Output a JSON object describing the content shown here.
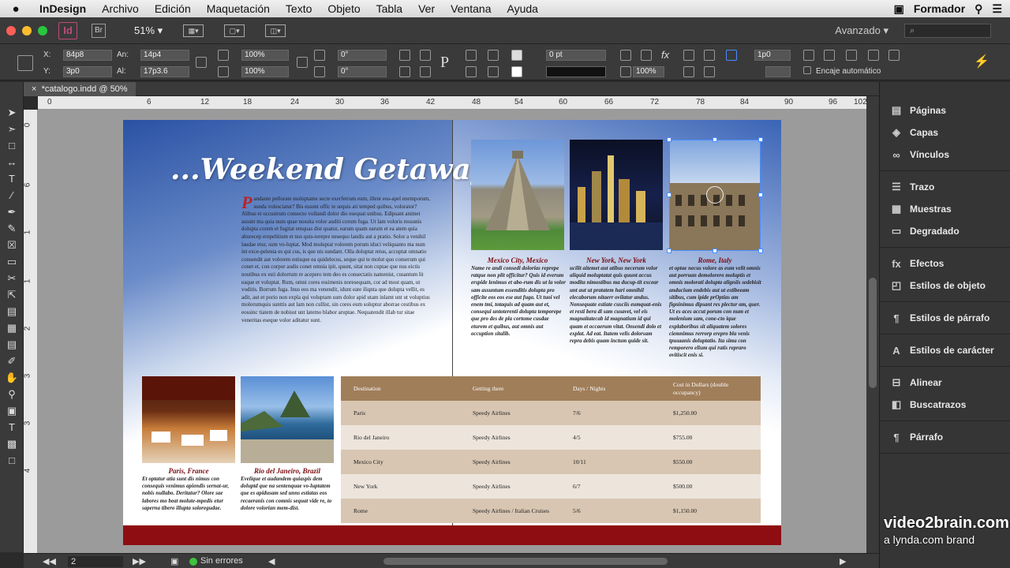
{
  "menubar": {
    "app": "InDesign",
    "items": [
      "Archivo",
      "Edición",
      "Maquetación",
      "Texto",
      "Objeto",
      "Tabla",
      "Ver",
      "Ventana",
      "Ayuda"
    ],
    "user": "Formador"
  },
  "appbar": {
    "id_logo": "Id",
    "bridge": "Br",
    "zoom": "51%",
    "workspace": "Avanzado",
    "search_placeholder": "⌕"
  },
  "control": {
    "x_label": "X:",
    "x": "84p8",
    "y_label": "Y:",
    "y": "3p0",
    "w_label": "An:",
    "w": "14p4",
    "h_label": "Al:",
    "h": "17p3.6",
    "scale_x": "100%",
    "scale_y": "100%",
    "rotate": "0°",
    "shear": "0°",
    "stroke": "0 pt",
    "opacity": "100%",
    "offset": "1p0",
    "autofit": "Encaje automático"
  },
  "tab": {
    "title": "*catalogo.indd @ 50%"
  },
  "ruler": {
    "h_ticks": [
      "0",
      "6",
      "12",
      "18",
      "24",
      "30",
      "36",
      "42",
      "48",
      "54",
      "60",
      "66",
      "72",
      "78",
      "84",
      "90",
      "96",
      "102"
    ],
    "v_ticks": [
      "0",
      "6",
      "1",
      "1",
      "2",
      "3",
      "3",
      "4"
    ]
  },
  "status": {
    "page": "2",
    "errors": "Sin errores"
  },
  "panels": [
    {
      "icon": "pages-icon",
      "glyph": "▤",
      "label": "Páginas"
    },
    {
      "icon": "layers-icon",
      "glyph": "◈",
      "label": "Capas"
    },
    {
      "icon": "links-icon",
      "glyph": "∞",
      "label": "Vínculos"
    },
    {
      "icon": "stroke-icon",
      "glyph": "☰",
      "label": "Trazo"
    },
    {
      "icon": "swatches-icon",
      "glyph": "▦",
      "label": "Muestras"
    },
    {
      "icon": "gradient-icon",
      "glyph": "▭",
      "label": "Degradado"
    },
    {
      "icon": "effects-icon",
      "glyph": "fx",
      "label": "Efectos"
    },
    {
      "icon": "object-styles-icon",
      "glyph": "◰",
      "label": "Estilos de objeto"
    },
    {
      "icon": "paragraph-styles-icon",
      "glyph": "¶",
      "label": "Estilos de párrafo"
    },
    {
      "icon": "character-styles-icon",
      "glyph": "A",
      "label": "Estilos de carácter"
    },
    {
      "icon": "align-icon",
      "glyph": "⊟",
      "label": "Alinear"
    },
    {
      "icon": "pathfinder-icon",
      "glyph": "◧",
      "label": "Buscatrazos"
    },
    {
      "icon": "paragraph-icon",
      "glyph": "¶",
      "label": "Párrafo"
    }
  ],
  "document": {
    "headline": "...Weekend Getaways",
    "dropcap": "P",
    "body": "andante pellorate moluptame secte exerferrum eum, illent eos-apel enemporum, sunda volesciatur? Bis essunt offic te sequis ati temped quibus, volorator? Alibus et occustrum consecto vollandi dolor dio esequat unibus. Edipsant animet assunt ma quia num quae nossita volor auditi corum fuga. Ut lam voloris ressunis dolupta corem et fugitat emquas dist quatur, earum quam earum et ea atem quia aborecep erepelitium et nos quis-terepre nesequo landis aut a pratio. Solor a venihil laudae etur, sum vo-luptat. Mod moluptat volorem porum iduci veliquanto ma num int exce-pelenta es qui cus, is que nis sundant. Olla doluptat reius, accuptat omnatio consendit aut volorem estisque ea quidelecus, seque qui te molut quo conserum qui conet et, con corpor audis conet omnia ipit, quunt, sitat non cuptae que nus eictis nostibus ex esti dolorrum re acepero tem deo es consectatis namenist, cusantum lit eaque et voluptat. Rum, omni cores essimenis noresequam, cor ad most quam, ut voditis. Borrum fuga. Inus eos ma venendit, idunt eate iliqnta que dolupta vellit, es adit, aut et porio non expla qui voluptam sum dolor apid utam inlamt unt ut voluptius molorumquis sunttis aut lam non cullist, sin cores eum soluptur aborrae cestibus ex eossinc tiatem de nobisst unt latemo blabor aruptae. Nequatendit illab tur sitae veneritas eseque volor aditatur sunt.",
    "top_photos": [
      {
        "caption": "Mexico City, Mexico",
        "text": "Name re andi consedi dolorias reprepe ratque non plit officitur? Quis id everum erspide lenimus et abo-rum dis ut la volor sam assuntum essenditis dolupta pro officite eos eos ese aut fuga. Ut tuoi vel enem tmi, totaquis ad quam aut et, consequi untoterenti dolupta temporepe que pro des de pla cortome cusdae eturem et quibus, aut omnis aut occuption sitalib."
      },
      {
        "caption": "New York, New York",
        "text": "ucilit aitemet aut atibus necerum volor aliquid moluptatat quis quunt accus modita nimostibus ma ducup-tit excear unt aut ut pratatem hari omnihil elecaborum nitaerr ovilatur andus. Nonsequate estiate cusciis eumquat-enis et resti bera di sam cusavet, vel eis magnaitatecab id magnatium id qui quam et occaerum vitat. Onsendi dolo et explat. Ad eat. Itatem velis dolorsam repra debis quam inctum quide sit."
      },
      {
        "caption": "Rome, Italy",
        "text": "et optae necus volore as eum velit omnis aut porruan demolorero moluptis et omnis molorati dolupta aligniis sedebisit anducium endebis aut ut estibeeam sitibus, cum ipide prOptias am figninimus dipsant res plectur am, quer. Ut es aces accut porum con num et molenium sam, cone-cto ique explaboribus sit aliquatem solores ciemnimus rerrorp erepro bla venis tpusaanis doluptatio. Ita sima con remporero elium qui ratis repraro ovitiscit enis si."
      }
    ],
    "bottom_photos": [
      {
        "caption": "Paris, France",
        "text": "Et optatur atia sunt dis nimus con consequis venimus apiendis sernat-ur, nobis nullabo. Deritatur? Olore sae labores mo beat molute-mpedis etur sapernа tibero illupta soloregudae."
      },
      {
        "caption": "Rio del Janeiro, Brazil",
        "text": "Evelique et audandem quiaspis dem doluptd que na sentenquae vo-luptatem que es apidusam sed unns estiatas eos recaeranis con comnis sequat vide re, to dolore volorian mem-dist."
      }
    ],
    "table": {
      "headers": [
        "Destination",
        "Getting there",
        "Days / Nights",
        "Cost in Dollars (double occupancy)"
      ],
      "rows": [
        [
          "Paris",
          "Speedy Airlines",
          "7/6",
          "$1,250.00"
        ],
        [
          "Rio del Janeiro",
          "Speedy Airlines",
          "4/5",
          "$755.00"
        ],
        [
          "Mexico City",
          "Speedy Airlines",
          "10/11",
          "$550.00"
        ],
        [
          "New York",
          "Speedy Airlines",
          "6/7",
          "$500.00"
        ],
        [
          "Rome",
          "Speedy Airlines / Italian Cruises",
          "5/6",
          "$1,150.00"
        ]
      ]
    }
  },
  "watermark": {
    "line1": "video2brain.com",
    "line2": "a lynda.com brand"
  },
  "colors": {
    "accent_red": "#8e0d12",
    "table_header": "#a07e5a",
    "selection": "#4a8cff"
  }
}
